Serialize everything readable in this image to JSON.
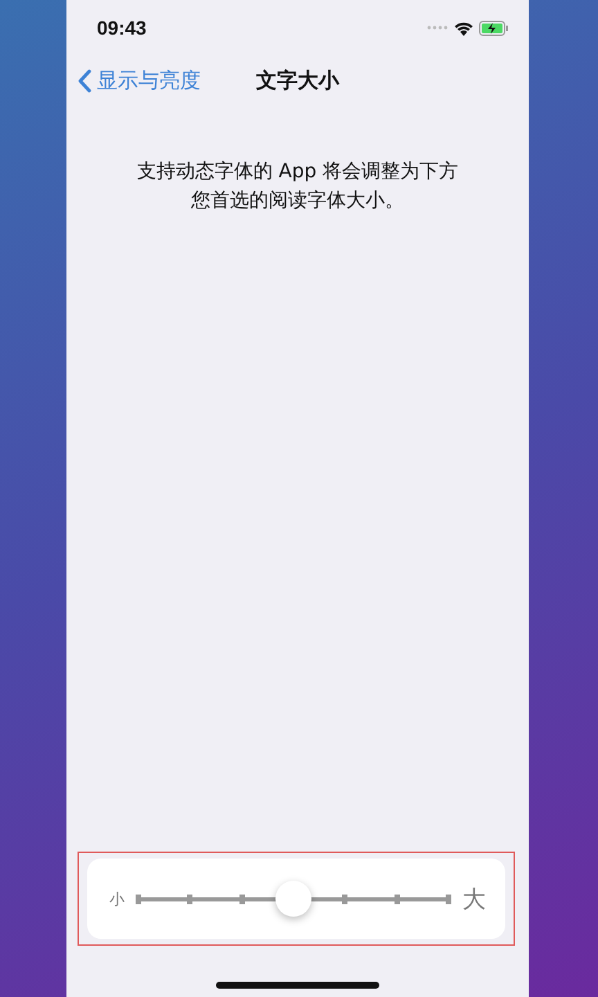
{
  "status_bar": {
    "time": "09:43"
  },
  "nav": {
    "back": "显示与亮度",
    "title": "文字大小"
  },
  "description": [
    "支持动态字体的 App 将会调整为下方",
    "您首选的阅读字体大小。"
  ],
  "slider": {
    "min_label": "小",
    "max_label": "大",
    "level": 0.5,
    "highlighted": true
  }
}
